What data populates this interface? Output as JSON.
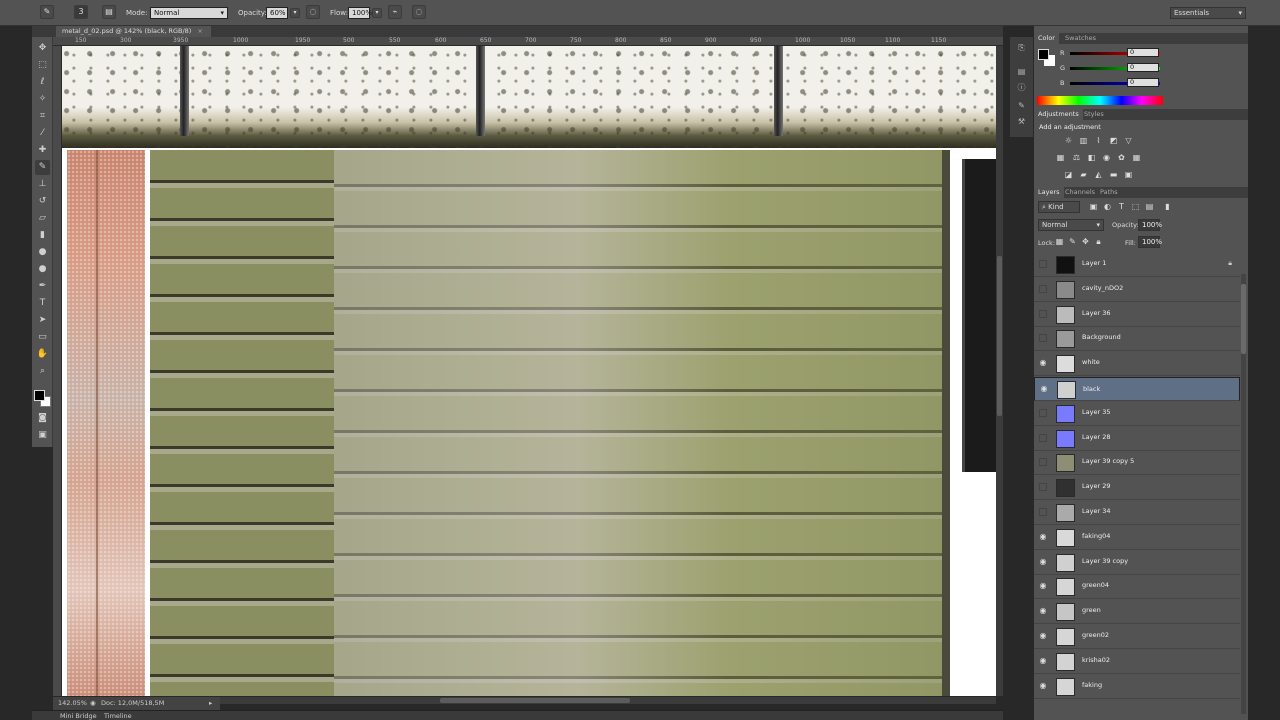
{
  "options_bar": {
    "mode_label": "Mode:",
    "mode_value": "Normal",
    "opacity_label": "Opacity:",
    "opacity_value": "60%",
    "flow_label": "Flow:",
    "flow_value": "100%",
    "brush_size": "3",
    "workspace": "Essentials"
  },
  "document": {
    "tab_title": "metal_d_02.psd @ 142% (black, RGB/8)",
    "close": "×"
  },
  "ruler": {
    "labels": [
      "150",
      "300",
      "3950",
      "1000",
      "1950",
      "500",
      "550",
      "600",
      "650",
      "700",
      "750",
      "800",
      "850",
      "900",
      "950",
      "1000",
      "1050",
      "1100",
      "1150"
    ]
  },
  "status": {
    "zoom": "142.05%",
    "doc": "Doc: 12,0M/518,5M"
  },
  "bottom_tabs": [
    "Mini Bridge",
    "Timeline"
  ],
  "color_panel": {
    "tabs": [
      "Color",
      "Swatches"
    ],
    "r_label": "R",
    "r_value": "0",
    "g_label": "G",
    "g_value": "0",
    "b_label": "B",
    "b_value": "0",
    "foreground": "#000000",
    "background": "#ffffff"
  },
  "adjustments_panel": {
    "tabs": [
      "Adjustments",
      "Styles"
    ],
    "heading": "Add an adjustment"
  },
  "layers_panel": {
    "tabs": [
      "Layers",
      "Channels",
      "Paths"
    ],
    "filter_kind": "Kind",
    "blend_mode": "Normal",
    "opacity_label": "Opacity:",
    "opacity_value": "100%",
    "lock_label": "Lock:",
    "fill_label": "Fill:",
    "fill_value": "100%",
    "layers": [
      {
        "name": "Layer 1",
        "visible": false,
        "locked": true,
        "thumb": "#111111"
      },
      {
        "name": "cavity_nDO2",
        "visible": false,
        "locked": false,
        "thumb": "#8a8a8a"
      },
      {
        "name": "Layer 36",
        "visible": false,
        "locked": false,
        "thumb": "#bbbbbb"
      },
      {
        "name": "Background",
        "visible": false,
        "locked": false,
        "thumb": "#9a9a9a"
      },
      {
        "name": "white",
        "visible": true,
        "locked": false,
        "thumb": "#dcdcdc"
      },
      {
        "name": "black",
        "visible": true,
        "locked": false,
        "thumb": "#d0d0d0",
        "selected": true
      },
      {
        "name": "Layer 35",
        "visible": false,
        "locked": false,
        "thumb": "#7a7aff"
      },
      {
        "name": "Layer 28",
        "visible": false,
        "locked": false,
        "thumb": "#7a7aff"
      },
      {
        "name": "Layer 39 copy 5",
        "visible": false,
        "locked": false,
        "thumb": "#8e8e74"
      },
      {
        "name": "Layer 29",
        "visible": false,
        "locked": false,
        "thumb": "#303030"
      },
      {
        "name": "Layer 34",
        "visible": false,
        "locked": false,
        "thumb": "#aaaaaa"
      },
      {
        "name": "faking04",
        "visible": true,
        "locked": false,
        "thumb": "#d9d9d9"
      },
      {
        "name": "Layer 39 copy",
        "visible": true,
        "locked": false,
        "thumb": "#d0d0d0"
      },
      {
        "name": "green04",
        "visible": true,
        "locked": false,
        "thumb": "#d6d6d6"
      },
      {
        "name": "green",
        "visible": true,
        "locked": false,
        "thumb": "#c6c6c6"
      },
      {
        "name": "green02",
        "visible": true,
        "locked": false,
        "thumb": "#d6d6d6"
      },
      {
        "name": "krisha02",
        "visible": true,
        "locked": false,
        "thumb": "#d3d3d3"
      },
      {
        "name": "faking",
        "visible": true,
        "locked": false,
        "thumb": "#d6d6d6"
      }
    ]
  }
}
